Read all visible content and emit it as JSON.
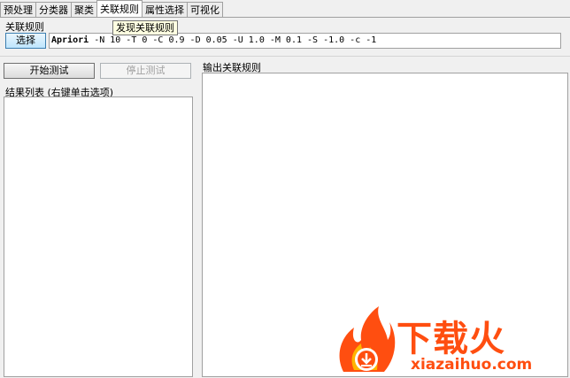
{
  "tabs": [
    {
      "label": "预处理"
    },
    {
      "label": "分类器"
    },
    {
      "label": "聚类"
    },
    {
      "label": "关联规则",
      "active": true
    },
    {
      "label": "属性选择"
    },
    {
      "label": "可视化"
    }
  ],
  "tooltip": "发现关联规则",
  "associator": {
    "section_label": "关联规则",
    "choose_label": "选择",
    "command_name": "Apriori",
    "command_args": "-N 10 -T 0 -C 0.9 -D 0.05 -U 1.0 -M 0.1 -S -1.0 -c -1"
  },
  "controls": {
    "start_label": "开始测试",
    "stop_label": "停止测试"
  },
  "results": {
    "label": "结果列表 (右键单击选项)"
  },
  "output": {
    "label": "输出关联规则"
  },
  "watermark": {
    "title": "下载火",
    "url": "xiazaihuo.com",
    "colors": {
      "brand": "#ff4e10",
      "accent": "#ffb400"
    }
  }
}
